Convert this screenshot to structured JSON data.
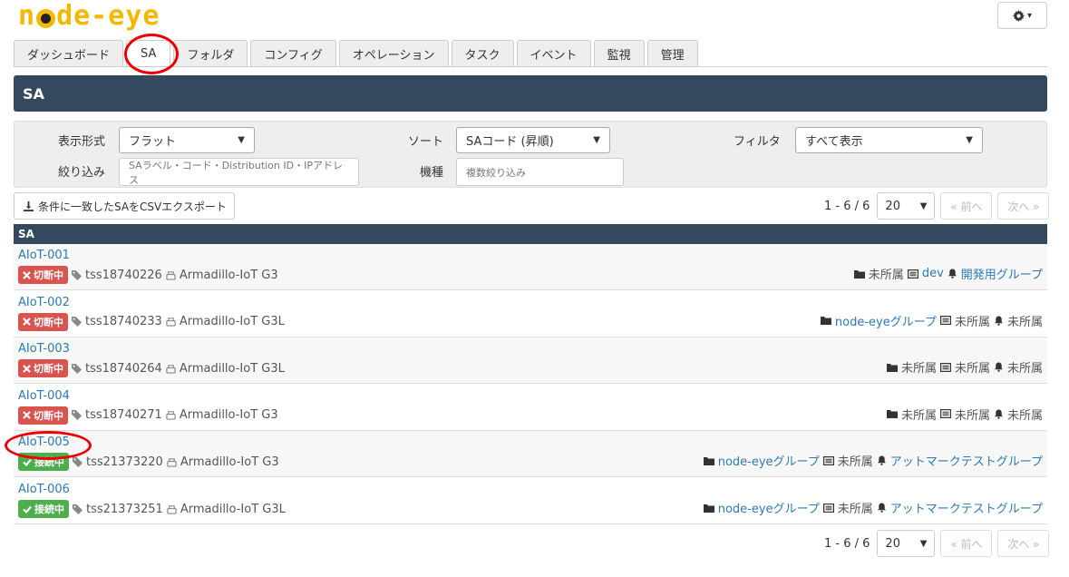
{
  "app": {
    "logo_pre": "n",
    "logo_post": "de-eye"
  },
  "settings": {
    "caret": "▾"
  },
  "tabs": [
    {
      "label": "ダッシュボード"
    },
    {
      "label": "SA"
    },
    {
      "label": "フォルダ"
    },
    {
      "label": "コンフィグ"
    },
    {
      "label": "オペレーション"
    },
    {
      "label": "タスク"
    },
    {
      "label": "イベント"
    },
    {
      "label": "監視"
    },
    {
      "label": "管理"
    }
  ],
  "page": {
    "title": "SA"
  },
  "filters": {
    "display_label": "表示形式",
    "display_value": "フラット",
    "sort_label": "ソート",
    "sort_value": "SAコード (昇順)",
    "filter_label": "フィルタ",
    "filter_value": "すべて表示",
    "narrow_label": "絞り込み",
    "narrow_placeholder": "SAラベル・コード・Distribution ID・IPアドレス",
    "model_label": "機種",
    "model_placeholder": "複数絞り込み"
  },
  "export": {
    "label": "条件に一致したSAをCSVエクスポート"
  },
  "pager": {
    "count": "1 - 6 / 6",
    "per_page": "20",
    "prev": "« 前へ",
    "next": "次へ »"
  },
  "list": {
    "header": "SA",
    "rows": [
      {
        "name": "AIoT-001",
        "status": "切断中",
        "status_type": "off",
        "tag": "tss18740226",
        "model": "Armadillo-IoT G3",
        "folder": "未所属",
        "folder_link": false,
        "config": "dev",
        "config_link": true,
        "group": "開発用グループ",
        "group_link": true
      },
      {
        "name": "AIoT-002",
        "status": "切断中",
        "status_type": "off",
        "tag": "tss18740233",
        "model": "Armadillo-IoT G3L",
        "folder": "node-eyeグループ",
        "folder_link": true,
        "config": "未所属",
        "config_link": false,
        "group": "未所属",
        "group_link": false
      },
      {
        "name": "AIoT-003",
        "status": "切断中",
        "status_type": "off",
        "tag": "tss18740264",
        "model": "Armadillo-IoT G3L",
        "folder": "未所属",
        "folder_link": false,
        "config": "未所属",
        "config_link": false,
        "group": "未所属",
        "group_link": false
      },
      {
        "name": "AIoT-004",
        "status": "切断中",
        "status_type": "off",
        "tag": "tss18740271",
        "model": "Armadillo-IoT G3",
        "folder": "未所属",
        "folder_link": false,
        "config": "未所属",
        "config_link": false,
        "group": "未所属",
        "group_link": false
      },
      {
        "name": "AIoT-005",
        "status": "接続中",
        "status_type": "on",
        "tag": "tss21373220",
        "model": "Armadillo-IoT G3",
        "folder": "node-eyeグループ",
        "folder_link": true,
        "config": "未所属",
        "config_link": false,
        "group": "アットマークテストグループ",
        "group_link": true
      },
      {
        "name": "AIoT-006",
        "status": "接続中",
        "status_type": "on",
        "tag": "tss21373251",
        "model": "Armadillo-IoT G3L",
        "folder": "node-eyeグループ",
        "folder_link": true,
        "config": "未所属",
        "config_link": false,
        "group": "アットマークテストグループ",
        "group_link": true
      }
    ]
  },
  "colors": {
    "accent": "#f5b800",
    "header": "#34495e",
    "link": "#2a7ab8",
    "danger": "#d9534f",
    "success": "#4cae4c",
    "annotation": "#e00000"
  }
}
